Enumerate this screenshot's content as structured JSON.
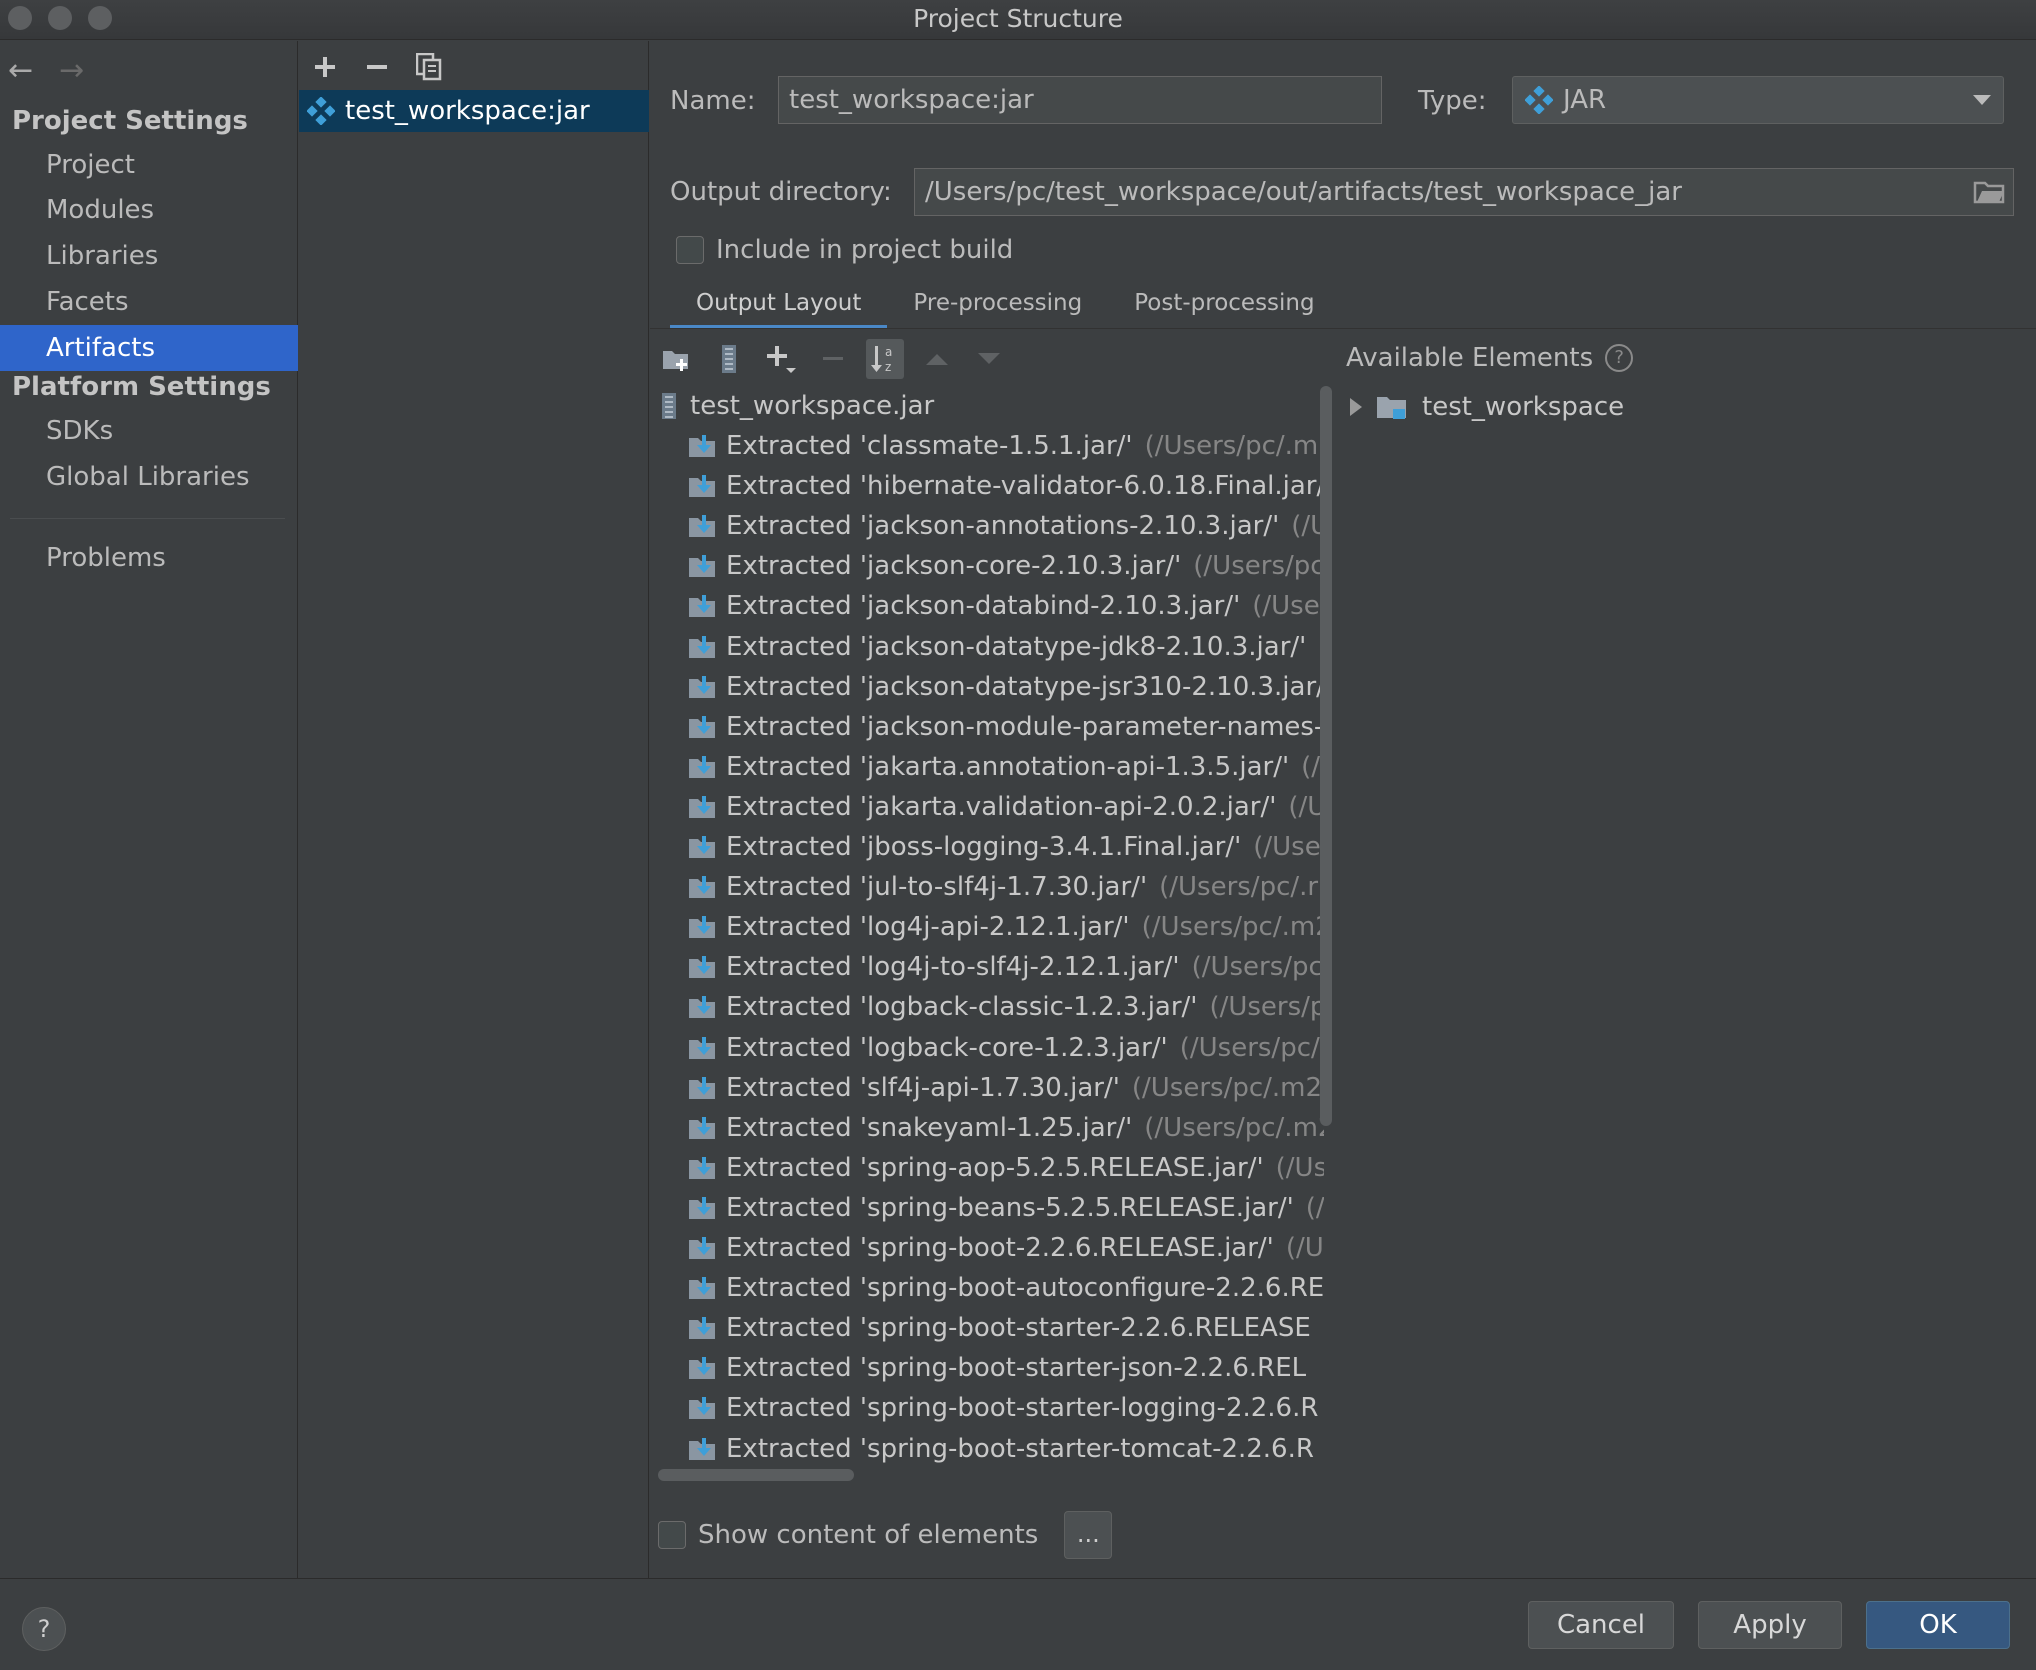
{
  "window": {
    "title": "Project Structure"
  },
  "nav": {
    "back_icon": "arrow-left-icon",
    "forward_icon": "arrow-right-icon",
    "project_settings_header": "Project Settings",
    "project_items": [
      "Project",
      "Modules",
      "Libraries",
      "Facets",
      "Artifacts"
    ],
    "selected_item": "Artifacts",
    "platform_settings_header": "Platform Settings",
    "platform_items": [
      "SDKs",
      "Global Libraries"
    ],
    "problems": "Problems"
  },
  "artifacts": {
    "toolbar": {
      "add_icon": "plus-icon",
      "remove_icon": "minus-icon",
      "copy_icon": "copy-icon"
    },
    "items": [
      {
        "label": "test_workspace:jar",
        "icon": "artifact-icon"
      }
    ]
  },
  "form": {
    "name_label": "Name:",
    "name_value": "test_workspace:jar",
    "type_label": "Type:",
    "type_value": "JAR",
    "output_label": "Output directory:",
    "output_value": "/Users/pc/test_workspace/out/artifacts/test_workspace_jar",
    "include_label": "Include in project build",
    "include_checked": false
  },
  "tabs": [
    "Output Layout",
    "Pre-processing",
    "Post-processing"
  ],
  "active_tab": "Output Layout",
  "layout_toolbar": [
    "new-folder-icon",
    "jar-icon",
    "plus-icon",
    "minus-icon",
    "sort-icon",
    "move-up-icon",
    "move-down-icon"
  ],
  "tree": {
    "root": "test_workspace.jar",
    "rows": [
      {
        "name": "Extracted 'classmate-1.5.1.jar/'",
        "path": "(/Users/pc/.m2"
      },
      {
        "name": "Extracted 'hibernate-validator-6.0.18.Final.jar/'",
        "path": ""
      },
      {
        "name": "Extracted 'jackson-annotations-2.10.3.jar/'",
        "path": "(/U"
      },
      {
        "name": "Extracted 'jackson-core-2.10.3.jar/'",
        "path": "(/Users/pc"
      },
      {
        "name": "Extracted 'jackson-databind-2.10.3.jar/'",
        "path": "(/User"
      },
      {
        "name": "Extracted 'jackson-datatype-jdk8-2.10.3.jar/'",
        "path": "(/"
      },
      {
        "name": "Extracted 'jackson-datatype-jsr310-2.10.3.jar/'",
        "path": ""
      },
      {
        "name": "Extracted 'jackson-module-parameter-names-",
        "path": ""
      },
      {
        "name": "Extracted 'jakarta.annotation-api-1.3.5.jar/'",
        "path": "(/U"
      },
      {
        "name": "Extracted 'jakarta.validation-api-2.0.2.jar/'",
        "path": "(/Us"
      },
      {
        "name": "Extracted 'jboss-logging-3.4.1.Final.jar/'",
        "path": "(/Use"
      },
      {
        "name": "Extracted 'jul-to-slf4j-1.7.30.jar/'",
        "path": "(/Users/pc/.r"
      },
      {
        "name": "Extracted 'log4j-api-2.12.1.jar/'",
        "path": "(/Users/pc/.m2"
      },
      {
        "name": "Extracted 'log4j-to-slf4j-2.12.1.jar/'",
        "path": "(/Users/pc"
      },
      {
        "name": "Extracted 'logback-classic-1.2.3.jar/'",
        "path": "(/Users/p"
      },
      {
        "name": "Extracted 'logback-core-1.2.3.jar/'",
        "path": "(/Users/pc/"
      },
      {
        "name": "Extracted 'slf4j-api-1.7.30.jar/'",
        "path": "(/Users/pc/.m2"
      },
      {
        "name": "Extracted 'snakeyaml-1.25.jar/'",
        "path": "(/Users/pc/.m2"
      },
      {
        "name": "Extracted 'spring-aop-5.2.5.RELEASE.jar/'",
        "path": "(/Us"
      },
      {
        "name": "Extracted 'spring-beans-5.2.5.RELEASE.jar/'",
        "path": "(/"
      },
      {
        "name": "Extracted 'spring-boot-2.2.6.RELEASE.jar/'",
        "path": "(/U"
      },
      {
        "name": "Extracted 'spring-boot-autoconfigure-2.2.6.RE",
        "path": ""
      },
      {
        "name": "Extracted 'spring-boot-starter-2.2.6.RELEASE",
        "path": ""
      },
      {
        "name": "Extracted 'spring-boot-starter-json-2.2.6.REL",
        "path": ""
      },
      {
        "name": "Extracted 'spring-boot-starter-logging-2.2.6.R",
        "path": ""
      },
      {
        "name": "Extracted 'spring-boot-starter-tomcat-2.2.6.R",
        "path": ""
      }
    ]
  },
  "available": {
    "title": "Available Elements",
    "help": "?",
    "items": [
      {
        "label": "test_workspace",
        "icon": "module-folder-icon"
      }
    ]
  },
  "show_content": {
    "label": "Show content of elements",
    "checked": false,
    "more": "..."
  },
  "footer": {
    "help": "?",
    "cancel": "Cancel",
    "apply": "Apply",
    "ok": "OK"
  },
  "colors": {
    "selection": "#2f65ca",
    "accent_tab": "#4a88c7",
    "ok_button": "#365880",
    "background": "#3c3f41"
  }
}
